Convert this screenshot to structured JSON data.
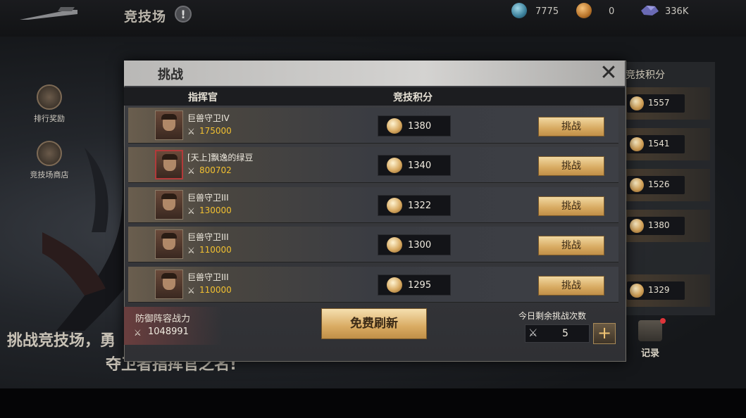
{
  "header": {
    "title": "竞技场",
    "info_icon": "info-icon",
    "resources": [
      {
        "icon": "gem-icon",
        "value": "7775",
        "color": "#3a7f9a"
      },
      {
        "icon": "medal-coin-icon",
        "value": "0",
        "color": "#b8742a"
      },
      {
        "icon": "ore-icon",
        "value": "336K",
        "color": "#6a6ab4"
      }
    ]
  },
  "side": {
    "rank_reward": "排行奖励",
    "arena_shop": "竞技场商店",
    "slogan_line1": "挑战竞技场，勇",
    "slogan_line2": "夺卫者指挥官之名!"
  },
  "ranking_panel": {
    "header": "竞技积分",
    "values": [
      "1557",
      "1541",
      "1526",
      "1380",
      "1329"
    ]
  },
  "record": {
    "label": "记录"
  },
  "dialog": {
    "title": "挑战",
    "close_icon": "close-icon",
    "columns": {
      "commander": "指挥官",
      "score": "竞技积分"
    },
    "rows": [
      {
        "name": "巨兽守卫IV",
        "power": "175000",
        "score": "1380",
        "button": "挑战",
        "special": false
      },
      {
        "name": "[天上]飘逸的绿豆",
        "power": "800702",
        "score": "1340",
        "button": "挑战",
        "special": true
      },
      {
        "name": "巨兽守卫III",
        "power": "130000",
        "score": "1322",
        "button": "挑战",
        "special": false
      },
      {
        "name": "巨兽守卫III",
        "power": "110000",
        "score": "1300",
        "button": "挑战",
        "special": false
      },
      {
        "name": "巨兽守卫III",
        "power": "110000",
        "score": "1295",
        "button": "挑战",
        "special": false
      }
    ],
    "defense": {
      "label": "防御阵容战力",
      "value": "1048991"
    },
    "refresh_button": "免费刷新",
    "remaining": {
      "label": "今日剩余挑战次数",
      "value": "5",
      "plus": "+"
    }
  }
}
